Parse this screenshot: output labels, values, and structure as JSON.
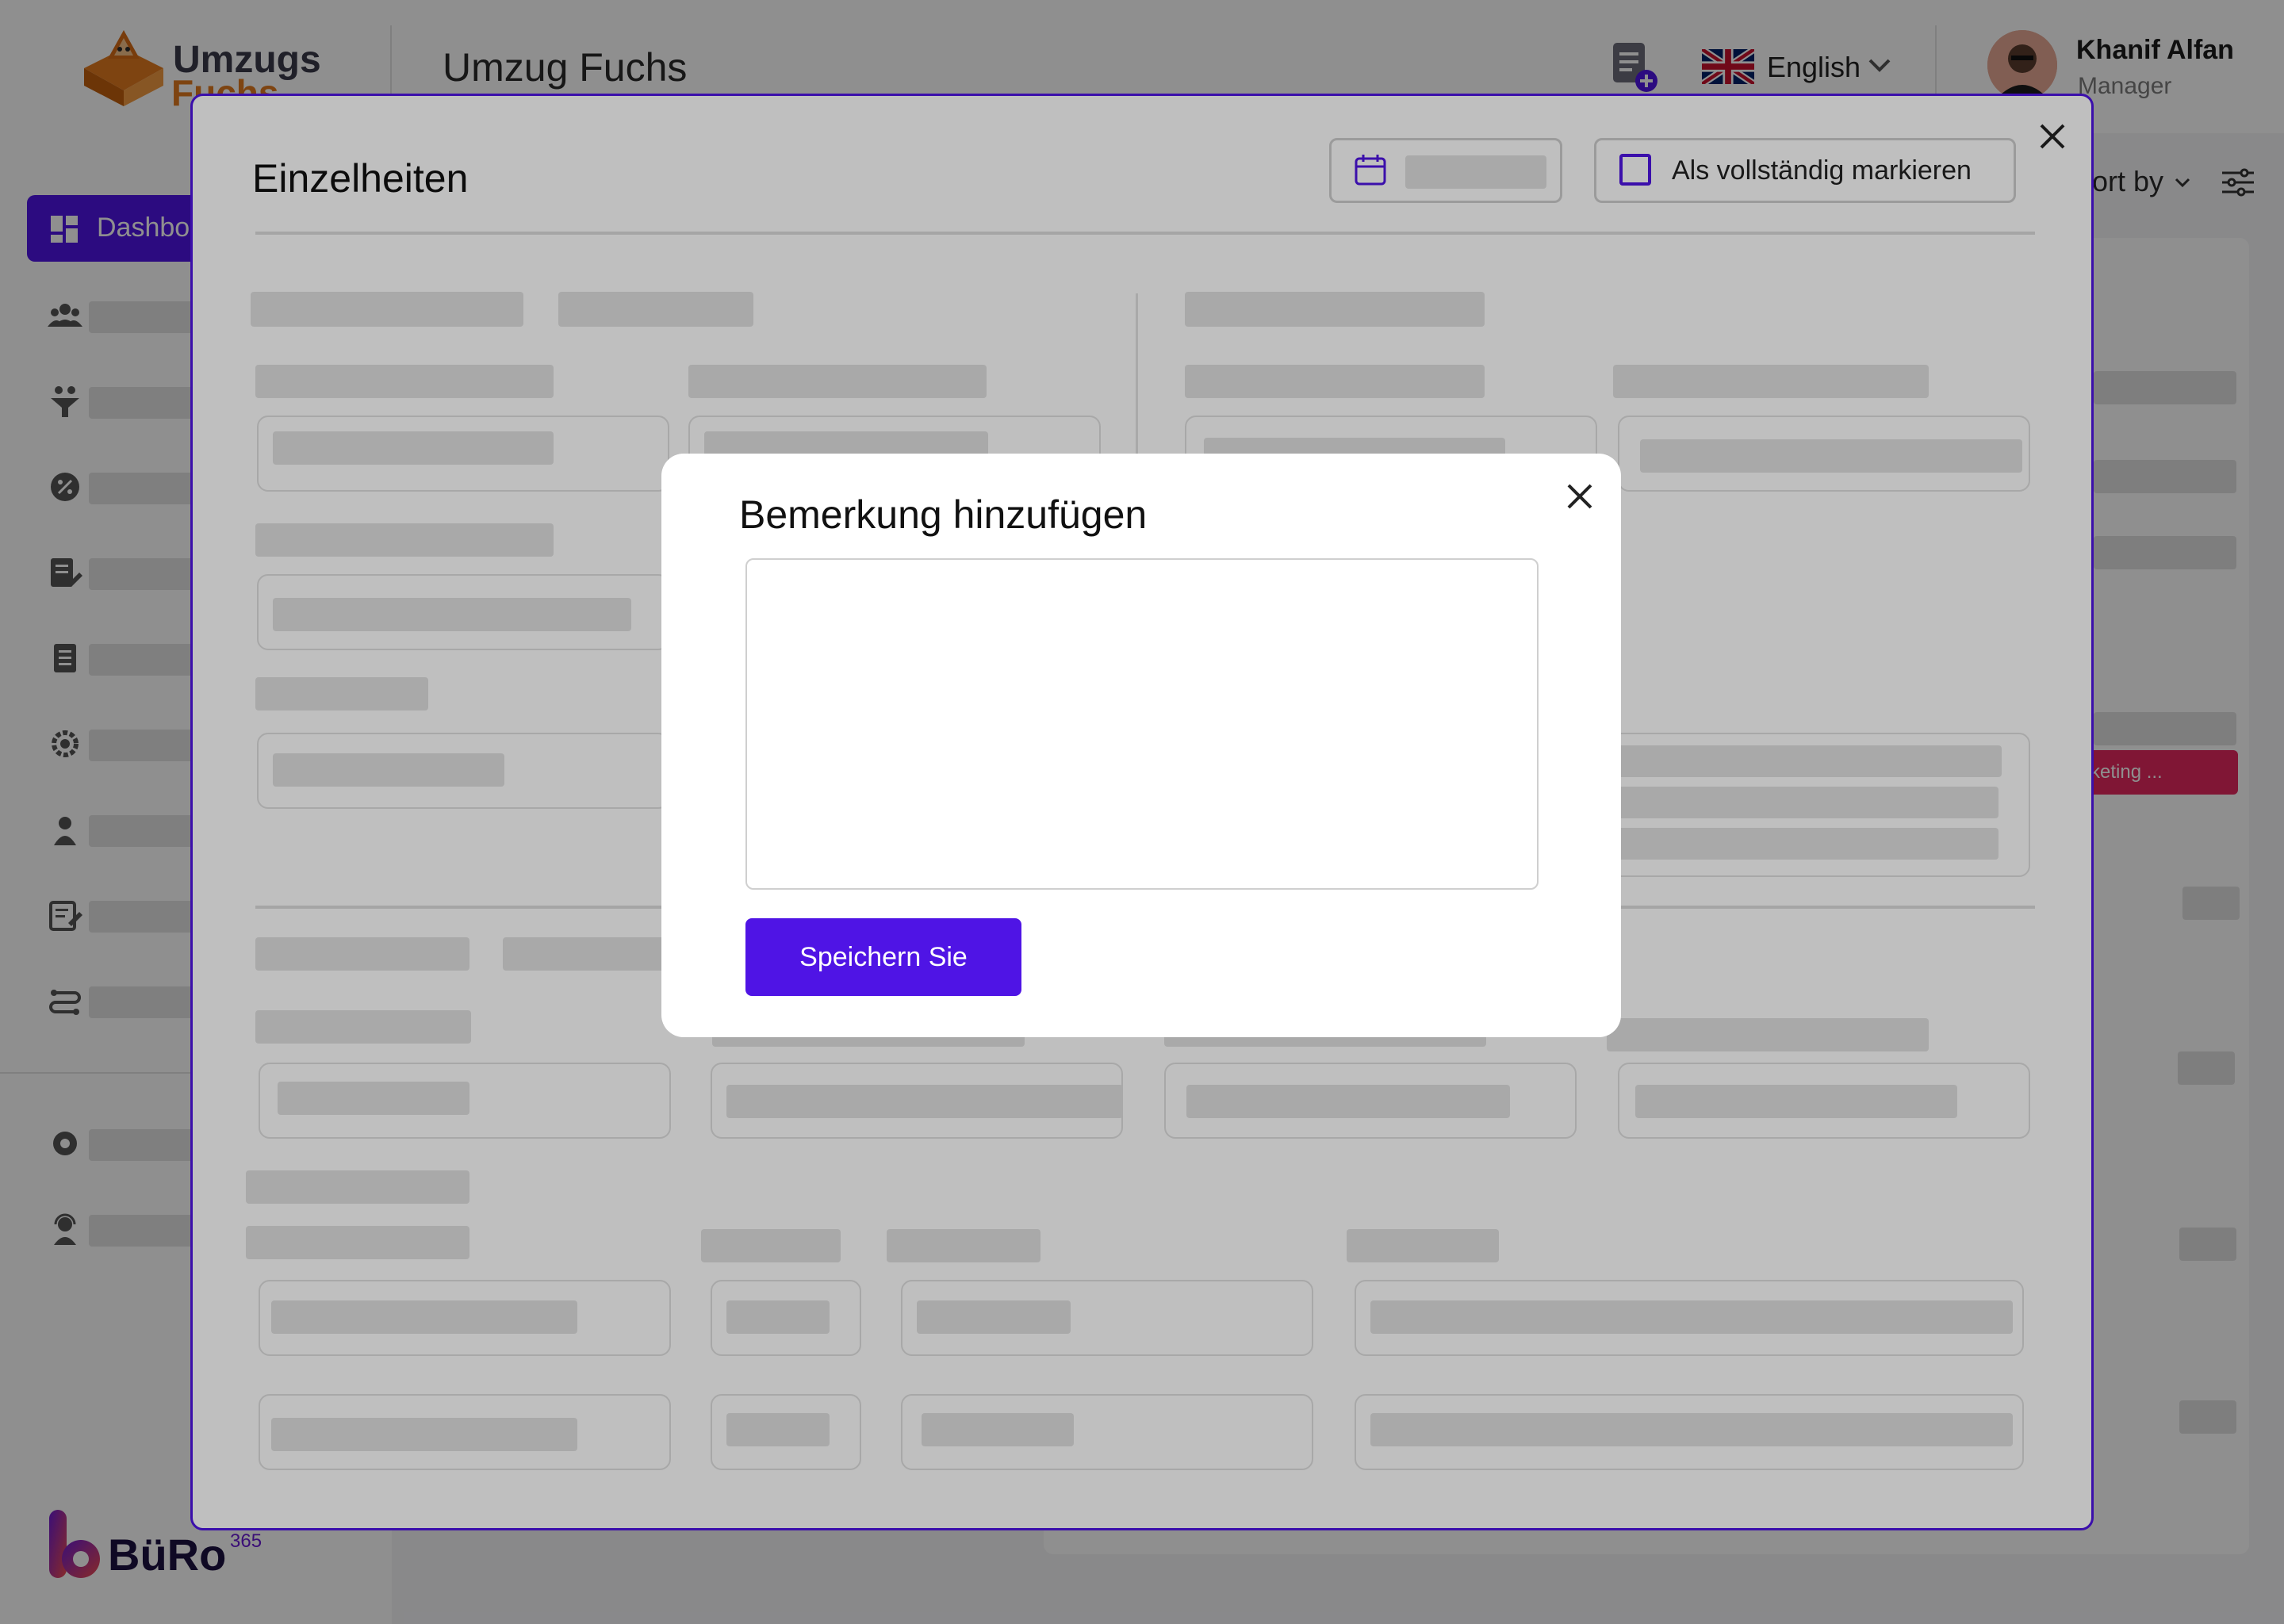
{
  "header": {
    "logo_line1": "Umzugs",
    "logo_line2": "Fuchs",
    "app_title": "Umzug Fuchs",
    "language": "English",
    "user_name": "Khanif Alfan",
    "user_role": "Manager"
  },
  "sidebar": {
    "active_item": "Dashbo",
    "icons": [
      "users-icon",
      "funnel-icon",
      "discount-icon",
      "edit-document-icon",
      "invoice-icon",
      "settings-gear-icon",
      "user-icon",
      "notes-icon",
      "route-icon",
      "settings-icon",
      "support-agent-icon"
    ],
    "brand": "BüRo",
    "brand_sup": "365"
  },
  "background": {
    "sort_label": "ort by",
    "pink_label": "rketing ..."
  },
  "details_modal": {
    "title": "Einzelheiten",
    "mark_complete_label": "Als vollständig markieren"
  },
  "remark_modal": {
    "title": "Bemerkung hinzufügen",
    "textarea_value": "",
    "save_label": "Speichern Sie"
  },
  "colors": {
    "accent": "#4f14e5",
    "pink": "#e4285f",
    "orange": "#e07a1f"
  }
}
